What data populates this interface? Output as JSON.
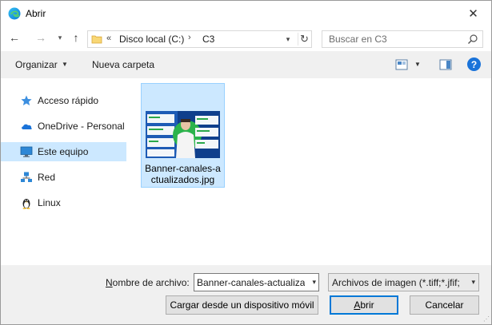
{
  "window": {
    "title": "Abrir",
    "app_icon": "edge-icon",
    "close_symbol": "✕"
  },
  "navbar": {
    "back_symbol": "←",
    "forward_symbol": "→",
    "recent_symbol": "▾",
    "up_symbol": "↑",
    "address": {
      "chevrons": "«",
      "crumbs": [
        "Disco local (C:)",
        "C3"
      ],
      "separator": "›",
      "dropdown_symbol": "▾",
      "refresh_symbol": "↻"
    },
    "search": {
      "placeholder": "Buscar en C3"
    }
  },
  "toolbar": {
    "organize_label": "Organizar",
    "organize_caret": "▼",
    "new_folder_label": "Nueva carpeta",
    "view_caret": "▼",
    "help_symbol": "?"
  },
  "navpane": {
    "items": [
      {
        "label": "Acceso rápido",
        "icon": "star-icon",
        "selected": false
      },
      {
        "label": "OneDrive - Personal",
        "icon": "cloud-icon",
        "selected": false
      },
      {
        "label": "Este equipo",
        "icon": "monitor-icon",
        "selected": true
      },
      {
        "label": "Red",
        "icon": "network-icon",
        "selected": false
      },
      {
        "label": "Linux",
        "icon": "penguin-icon",
        "selected": false
      }
    ]
  },
  "content": {
    "files": [
      {
        "name": "Banner-canales-actualizados.jpg",
        "name_line1": "Banner-canales-a",
        "name_line2": "ctualizados.jpg",
        "selected": true
      }
    ]
  },
  "bottom": {
    "file_name_label": "Nombre de archivo:",
    "file_name_value": "Banner-canales-actualiza",
    "file_name_caret": "▾",
    "filter_value": "Archivos de imagen (*.tiff;*.jfif;",
    "filter_caret": "▾",
    "upload_button": "Cargar desde un dispositivo móvil",
    "open_button": "Abrir",
    "cancel_button": "Cancelar"
  },
  "colors": {
    "selection": "#cce8ff",
    "accent": "#0078d7",
    "panel": "#f0f0f0"
  }
}
